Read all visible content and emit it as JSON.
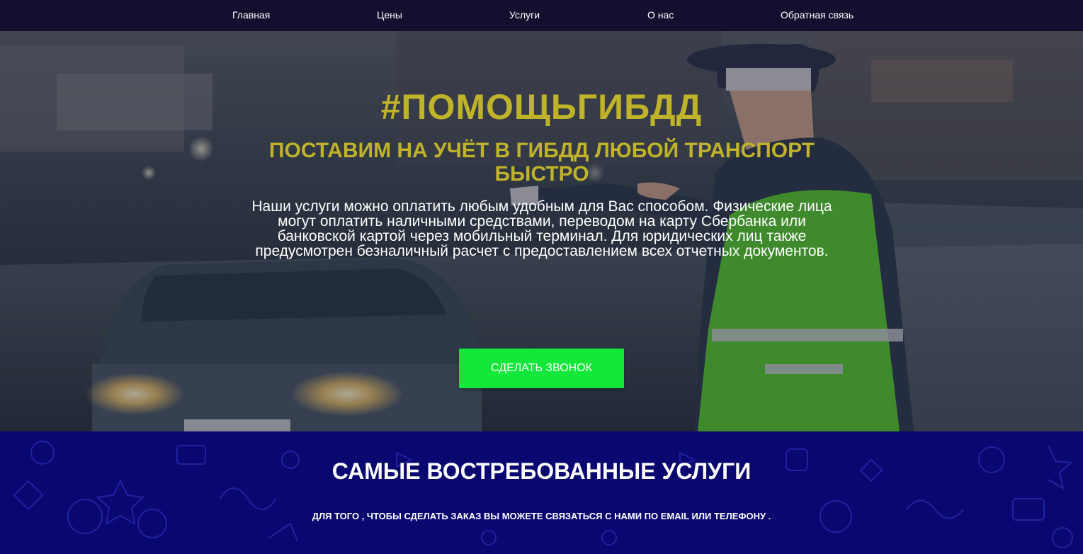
{
  "nav": {
    "items": [
      {
        "label": "Главная"
      },
      {
        "label": "Цены"
      },
      {
        "label": "Услуги"
      },
      {
        "label": "О нас"
      },
      {
        "label": "Обратная связь"
      }
    ]
  },
  "hero": {
    "title": "#ПОМОЩЬГИБДД",
    "subtitle": "ПОСТАВИМ НА УЧЁТ В ГИБДД ЛЮБОЙ ТРАНСПОРТ БЫСТРО",
    "text": "Наши услуги можно оплатить любым удобным для Вас способом. Физические лица могут оплатить наличными средствами, переводом на карту Сбербанка или банковской картой через мобильный терминал. Для юридических лиц также предусмотрен безналичный расчет с предоставлением всех отчетных документов.",
    "cta_label": "СДЕЛАТЬ ЗВОНОК"
  },
  "services": {
    "title": "САМЫЕ ВОСТРЕБОВАННЫЕ УСЛУГИ",
    "note": "ДЛЯ ТОГО , ЧТОБЫ СДЕЛАТЬ ЗАКАЗ ВЫ МОЖЕТЕ СВЯЗАТЬСЯ С НАМИ ПО EMAIL ИЛИ ТЕЛЕФОНУ ."
  },
  "colors": {
    "nav_bg": "#160e2e",
    "accent_yellow": "#bfb32a",
    "cta_green": "#13e83a",
    "services_bg": "#0a0770"
  }
}
